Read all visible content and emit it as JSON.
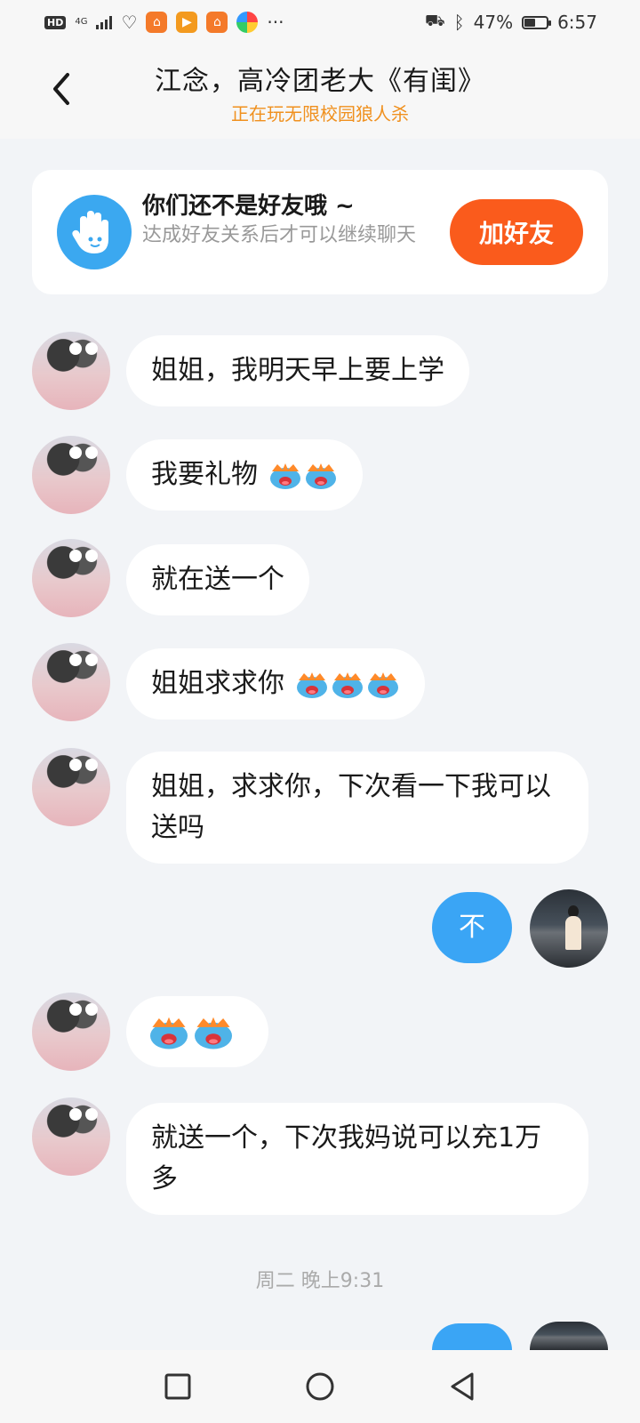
{
  "status_bar": {
    "hd": "HD",
    "network": "4G",
    "battery_percent": "47%",
    "battery_level": 0.47,
    "time": "6:57",
    "more": "···"
  },
  "header": {
    "back_icon": "chevron-left-icon",
    "title": "江念，高冷团老大《有闺》",
    "subtitle": "正在玩无限校园狼人杀",
    "subtitle_color": "#f0901e"
  },
  "friend_card": {
    "icon": "waving-hand-icon",
    "title": "你们还不是好友哦 ~",
    "description": "达成好友关系后才可以继续聊天",
    "button_label": "加好友",
    "button_color": "#fa5b1c"
  },
  "messages": [
    {
      "side": "left",
      "text": "姐姐，我明天早上要上学",
      "emoji_count": 0
    },
    {
      "side": "left",
      "text": "我要礼物",
      "emoji_count": 2
    },
    {
      "side": "left",
      "text": "就在送一个",
      "emoji_count": 0
    },
    {
      "side": "left",
      "text": "姐姐求求你",
      "emoji_count": 3
    },
    {
      "side": "left",
      "text": "姐姐，求求你，下次看一下我可以送吗",
      "emoji_count": 0
    },
    {
      "side": "right",
      "text": "不",
      "emoji_count": 0
    },
    {
      "side": "left",
      "text": "",
      "emoji_count": 2
    },
    {
      "side": "left",
      "text": "就送一个，下次我妈说可以充1万多",
      "emoji_count": 0
    }
  ],
  "timestamp": "周二 晚上9:31",
  "nav": {
    "recents": "square-icon",
    "home": "circle-icon",
    "back": "triangle-back-icon"
  },
  "colors": {
    "my_bubble": "#3aa5f5",
    "background": "#f2f4f7"
  }
}
